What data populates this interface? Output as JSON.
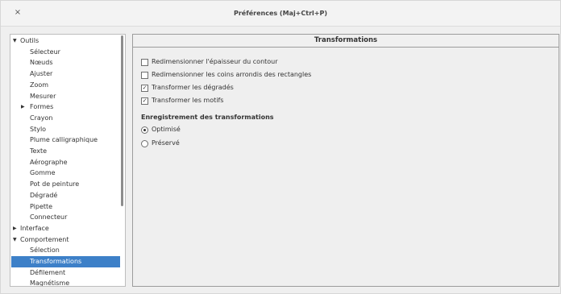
{
  "window": {
    "title": "Préférences (Maj+Ctrl+P)",
    "close_glyph": "×"
  },
  "tree": {
    "items": [
      {
        "label": "Outils",
        "level": 0,
        "expanded": true
      },
      {
        "label": "Sélecteur",
        "level": 1
      },
      {
        "label": "Nœuds",
        "level": 1
      },
      {
        "label": "Ajuster",
        "level": 1
      },
      {
        "label": "Zoom",
        "level": 1
      },
      {
        "label": "Mesurer",
        "level": 1
      },
      {
        "label": "Formes",
        "level": 1,
        "collapsed": true
      },
      {
        "label": "Crayon",
        "level": 1
      },
      {
        "label": "Stylo",
        "level": 1
      },
      {
        "label": "Plume calligraphique",
        "level": 1
      },
      {
        "label": "Texte",
        "level": 1
      },
      {
        "label": "Aérographe",
        "level": 1
      },
      {
        "label": "Gomme",
        "level": 1
      },
      {
        "label": "Pot de peinture",
        "level": 1
      },
      {
        "label": "Dégradé",
        "level": 1
      },
      {
        "label": "Pipette",
        "level": 1
      },
      {
        "label": "Connecteur",
        "level": 1
      },
      {
        "label": "Interface",
        "level": 0,
        "collapsed": true
      },
      {
        "label": "Comportement",
        "level": 0,
        "expanded": true
      },
      {
        "label": "Sélection",
        "level": 1
      },
      {
        "label": "Transformations",
        "level": 1,
        "selected": true
      },
      {
        "label": "Défilement",
        "level": 1
      },
      {
        "label": "Magnétisme",
        "level": 1
      }
    ]
  },
  "panel": {
    "header": "Transformations",
    "checkboxes": [
      {
        "label": "Redimensionner l'épaisseur du contour",
        "checked": false
      },
      {
        "label": "Redimensionner les coins arrondis des rectangles",
        "checked": false
      },
      {
        "label": "Transformer les dégradés",
        "checked": true
      },
      {
        "label": "Transformer les motifs",
        "checked": true
      }
    ],
    "section_title": "Enregistrement des transformations",
    "radios": [
      {
        "label": "Optimisé",
        "selected": true
      },
      {
        "label": "Préservé",
        "selected": false
      }
    ]
  },
  "colors": {
    "selection": "#3d80c8"
  }
}
